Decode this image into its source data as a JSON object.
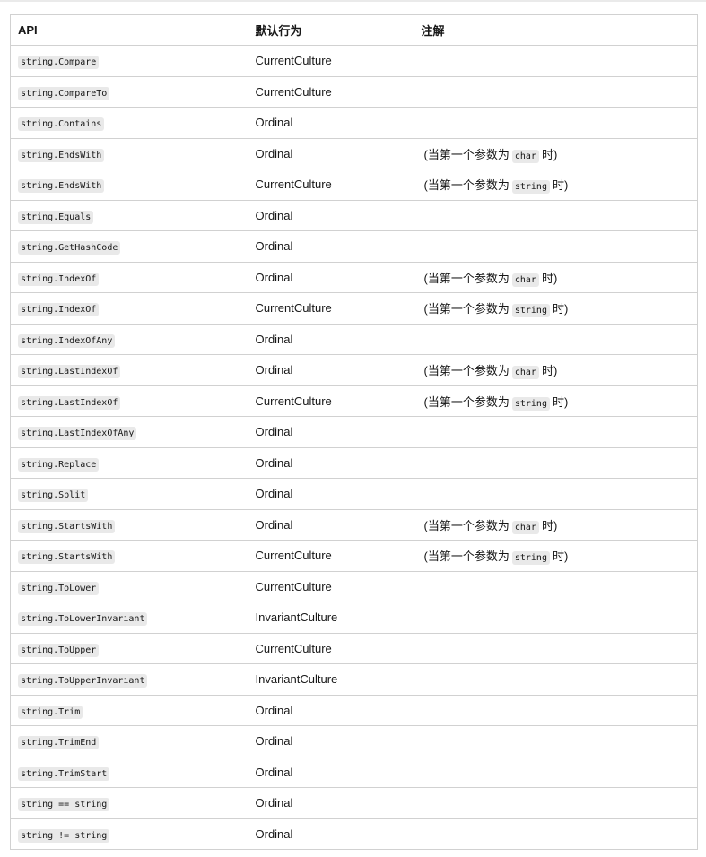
{
  "table": {
    "headers": [
      "API",
      "默认行为",
      "注解"
    ],
    "note_prefix": "(当第一个参数为",
    "note_suffix": "时)",
    "rows": [
      {
        "api": "string.Compare",
        "behavior": "CurrentCulture",
        "note_type": ""
      },
      {
        "api": "string.CompareTo",
        "behavior": "CurrentCulture",
        "note_type": ""
      },
      {
        "api": "string.Contains",
        "behavior": "Ordinal",
        "note_type": ""
      },
      {
        "api": "string.EndsWith",
        "behavior": "Ordinal",
        "note_type": "char"
      },
      {
        "api": "string.EndsWith",
        "behavior": "CurrentCulture",
        "note_type": "string"
      },
      {
        "api": "string.Equals",
        "behavior": "Ordinal",
        "note_type": ""
      },
      {
        "api": "string.GetHashCode",
        "behavior": "Ordinal",
        "note_type": ""
      },
      {
        "api": "string.IndexOf",
        "behavior": "Ordinal",
        "note_type": "char"
      },
      {
        "api": "string.IndexOf",
        "behavior": "CurrentCulture",
        "note_type": "string"
      },
      {
        "api": "string.IndexOfAny",
        "behavior": "Ordinal",
        "note_type": ""
      },
      {
        "api": "string.LastIndexOf",
        "behavior": "Ordinal",
        "note_type": "char"
      },
      {
        "api": "string.LastIndexOf",
        "behavior": "CurrentCulture",
        "note_type": "string"
      },
      {
        "api": "string.LastIndexOfAny",
        "behavior": "Ordinal",
        "note_type": ""
      },
      {
        "api": "string.Replace",
        "behavior": "Ordinal",
        "note_type": ""
      },
      {
        "api": "string.Split",
        "behavior": "Ordinal",
        "note_type": ""
      },
      {
        "api": "string.StartsWith",
        "behavior": "Ordinal",
        "note_type": "char"
      },
      {
        "api": "string.StartsWith",
        "behavior": "CurrentCulture",
        "note_type": "string"
      },
      {
        "api": "string.ToLower",
        "behavior": "CurrentCulture",
        "note_type": ""
      },
      {
        "api": "string.ToLowerInvariant",
        "behavior": "InvariantCulture",
        "note_type": ""
      },
      {
        "api": "string.ToUpper",
        "behavior": "CurrentCulture",
        "note_type": ""
      },
      {
        "api": "string.ToUpperInvariant",
        "behavior": "InvariantCulture",
        "note_type": ""
      },
      {
        "api": "string.Trim",
        "behavior": "Ordinal",
        "note_type": ""
      },
      {
        "api": "string.TrimEnd",
        "behavior": "Ordinal",
        "note_type": ""
      },
      {
        "api": "string.TrimStart",
        "behavior": "Ordinal",
        "note_type": ""
      },
      {
        "api": "string == string",
        "behavior": "Ordinal",
        "note_type": ""
      },
      {
        "api": "string != string",
        "behavior": "Ordinal",
        "note_type": ""
      }
    ]
  }
}
